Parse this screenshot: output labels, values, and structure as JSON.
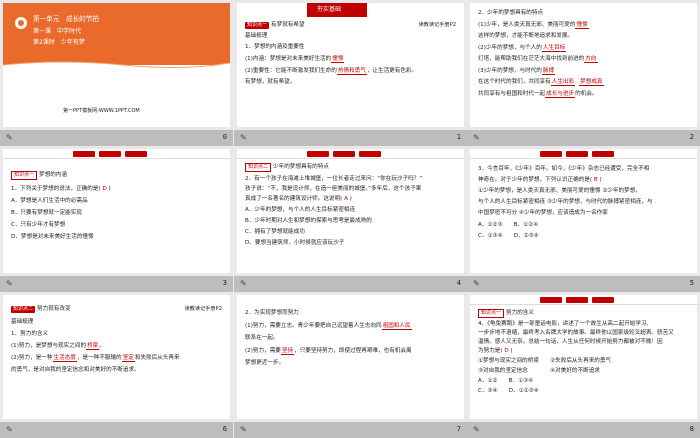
{
  "slides": [
    {
      "num": "0",
      "title": {
        "unit": "第一单元　成长的节拍",
        "lesson": "第一课　中学时代",
        "period": "第2课时　少年有梦"
      },
      "footer": "第一PPT模板网-WWW.1PPT.COM"
    },
    {
      "num": "1",
      "banner": "夯实基础",
      "banner_sub": "· 分层训练",
      "tag": "知识点一",
      "heading": "有梦就有希望",
      "ref": "读教读记手册P2",
      "lines": [
        "基础梳理",
        "1．梦想的内涵及重要性",
        "(1)内涵：梦想是对未来美好生活的",
        "(2)重要性：它能不断激发我们生命的",
        "有梦想，就有希望。"
      ],
      "blank1": "憧憬",
      "blank2": "热情和勇气",
      "line3b": "，让生活更有色彩。"
    },
    {
      "num": "2",
      "lines": [
        "2．少年的梦想具有的特点",
        "(1)少年，是人类天真无邪、美丽可爱的",
        "这样的梦想，才能不断地追求和发展。",
        "(2)少年的梦想，与个人的",
        "灯塔，能帮助我们在茫茫大海中找到前进的",
        "(3)少年的梦想，与时代的",
        "在这个时代的我们，共同享有",
        "共同享有与祖国和时代一起",
        "的机会。"
      ],
      "blanks": [
        "憧憬",
        "人生目标",
        "方向",
        "脉搏",
        "人生出彩",
        "梦想成真",
        "成长与进步"
      ]
    },
    {
      "num": "3",
      "tag": "知识点一",
      "heading": "梦想的内涵",
      "lines": [
        "1．下列关于梦想的说法，正确的是(",
        "A．梦想是人们生活中的必需品",
        "B．只要有梦想就一定能实现",
        "C．只有少年才有梦想",
        "D．梦想是对未来美好生活的憧憬"
      ],
      "answer": "D"
    },
    {
      "num": "4",
      "tag": "知识点二",
      "heading": "少年的梦想具有的特点",
      "lines": [
        "2．有一个孩子在海滩上堆城堡，一位长者走过来问：“你在玩沙子吗？”",
        "孩子说：“不，我是设计师，在造一座美丽的城堡。”多年后，这个孩子果",
        "真成了一名著名的建筑设计师。这说明(",
        "A．少年的梦想，与个人的人生目标紧密相连",
        "B．少年时期对人生和梦想的探索与思考是最成熟的",
        "C．拥有了梦想就能成功",
        "D．要想当建筑师，小时候就应该玩沙子"
      ],
      "answer": "A"
    },
    {
      "num": "5",
      "lines": [
        "3．今言百年，《少年》百年。如今，《少年》杂志已经遭受，完全不相",
        "神奇在。对于少年的梦想，下列认识正确的是(",
        "①少年的梦想，是人类天真无邪、美丽可爱的憧憬 ②少年的梦想，",
        "与个人的人生目标紧密相连 ③少年的梦想，与时代的脉搏紧密相连，与",
        "中国梦密不可分 ④少年的梦想，应该造成为一名作家",
        "A．①②③　　B．①②④",
        "C．①③④　　D．②③④"
      ],
      "answer": "B"
    },
    {
      "num": "6",
      "tag": "知识点二",
      "heading": "努力就有改变",
      "ref": "读教读记手册P2",
      "lines": [
        "基础梳理",
        "1．努力的含义",
        "(1)努力，是梦想与现实之间的",
        "(2)努力，是一种",
        "的勇气，是对自我的坚定信念和对美好的不断追求。"
      ],
      "blanks": [
        "桥梁",
        "生活态度",
        "坚定",
        "失败后从头再来"
      ],
      "line4b": "，是一种不服输的",
      "line4c": "和失败后从头再来"
    },
    {
      "num": "7",
      "lines": [
        "2．为实现梦想而努力",
        "(1)努力，需要立志。青少年要把自己远望着人生志向同",
        "联系在一起。",
        "(2)努力，需要",
        "，只要坚持努力，即使过程再艰难，也有机会离",
        "梦想更近一步。"
      ],
      "blanks": [
        "祖国和人民",
        "坚持"
      ]
    },
    {
      "num": "8",
      "tag": "知识点一",
      "heading": "努力的含义",
      "lines": [
        "4．《龟兔赛跑》是一部童话电影，讲述了一个故生从高二起开始学习,",
        "一步步地不退缩，最终考入名牌大学的故事。最终他以国家级轮叉超表。骄苦又",
        "温情。感人又无奈。总结一句话，人生从任何时候开始努力都被对不晚！因",
        "为努力是(",
        "①梦想与现实之间的桥梁　　②失败后从头再来的勇气",
        "③对自我的坚定信念　　　　④对美好的不断追求",
        "A．①②　　B．①③④",
        "C．③④　　D．①②③④"
      ],
      "answer": "D"
    }
  ],
  "bar_icon": "comment-icon"
}
